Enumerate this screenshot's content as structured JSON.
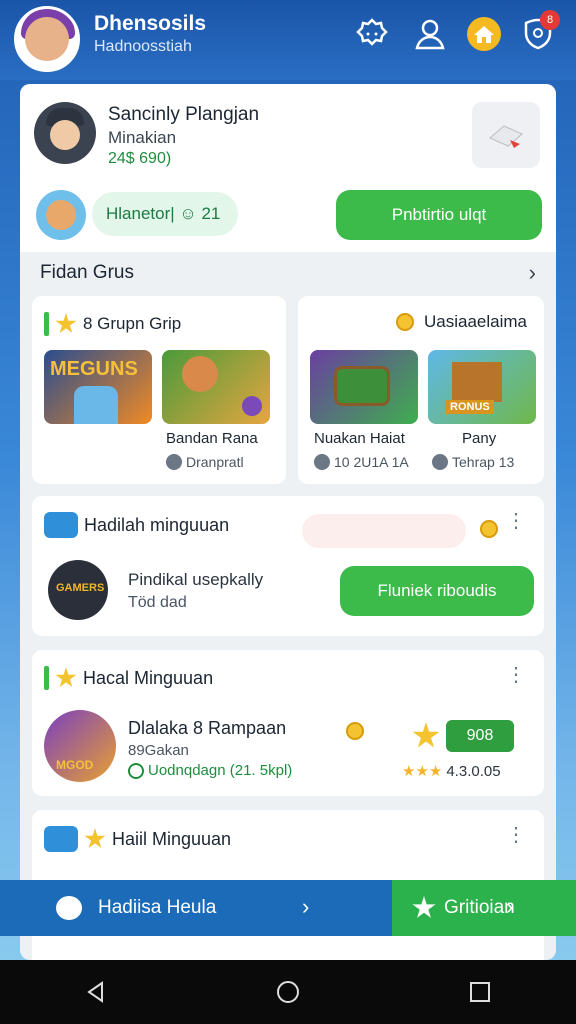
{
  "header": {
    "title": "Dhensosils",
    "subtitle": "Hadnoosstiah",
    "notification_count": "8"
  },
  "profile": {
    "name": "Sancinly Plangjan",
    "role": "Minakian",
    "amount": "24$ 690)",
    "pill_text": "Hlanetor| ☺ 21",
    "primary_button": "Pnbtirtio ulqt"
  },
  "section": {
    "title": "Fidan Grus"
  },
  "game_groups": [
    {
      "title": "8 Grupn Grip",
      "games": [
        {
          "thumb_text": "MEGUNS",
          "label": "",
          "stat": ""
        },
        {
          "thumb_text": "",
          "label": "Bandan Rana",
          "stat": "Dranpratl"
        }
      ]
    },
    {
      "title": "Uasiaaelaima",
      "games": [
        {
          "thumb_text": "",
          "label": "Nuakan Haiat",
          "stat": "10 2U1A 1A"
        },
        {
          "thumb_text": "RONUS",
          "label": "Pany",
          "stat": "Tehrap 13"
        }
      ]
    }
  ],
  "weekly_reward": {
    "title": "Hadilah minguuan",
    "text": "Pindikal usepkally",
    "subtext": "Töd dad",
    "button": "Fluniek riboudis",
    "thumb_text": "GAMERS"
  },
  "weekly_list": {
    "title": "Hacal Minguuan",
    "item": {
      "name": "Dlalaka 8 Rampaan",
      "sub": "89Gakan",
      "status": "Uodnqdagn (21. 5kpl)",
      "price": "908",
      "rating": "4.3.0.05",
      "thumb_text": "MGOD"
    }
  },
  "bottom_card": {
    "title": "Haiil Minguuan"
  },
  "bottom_bar": {
    "left_label": "Hadiisa Heula",
    "right_label": "Gritioian"
  },
  "colors": {
    "primary_green": "#3dbb4a",
    "header_blue": "#1a55a8",
    "bar_blue": "#1c6bb8"
  }
}
